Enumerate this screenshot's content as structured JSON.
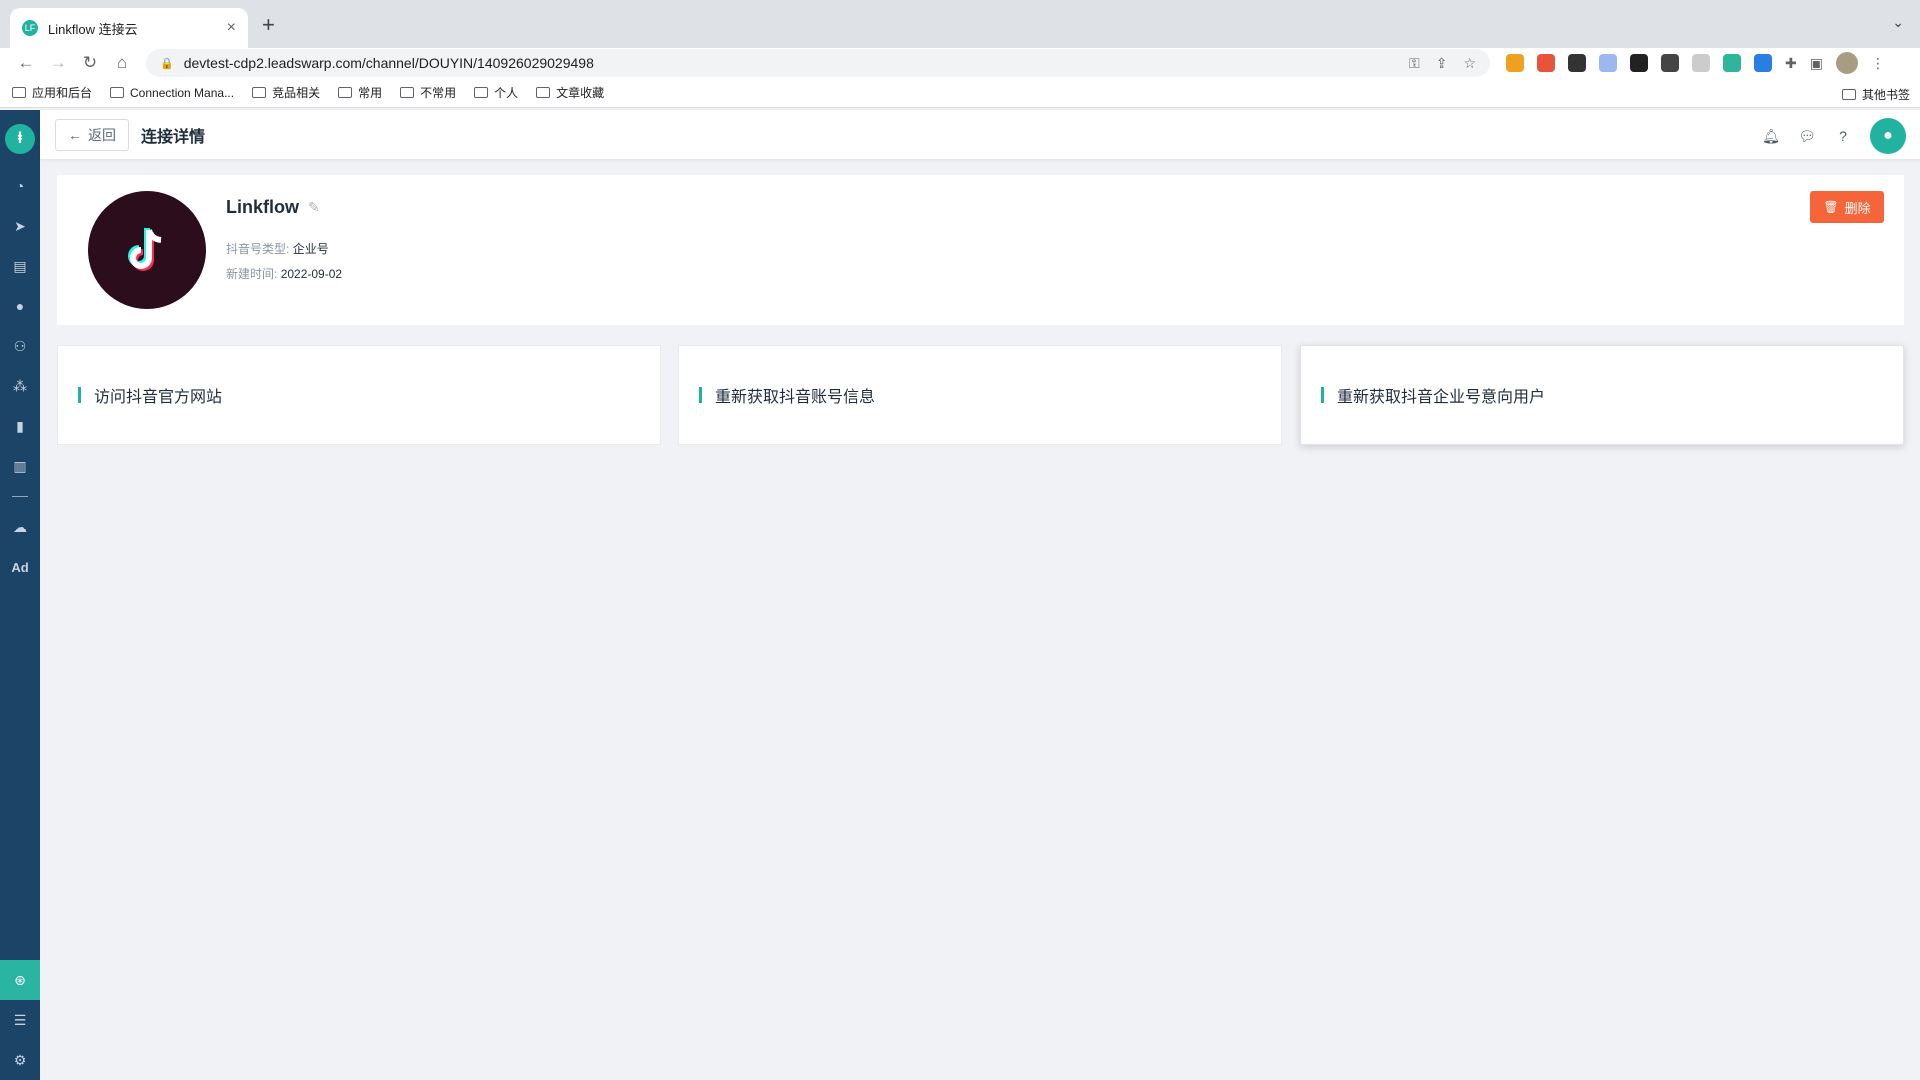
{
  "browser": {
    "tab_title": "Linkflow 连接云",
    "tab_close": "×",
    "new_tab": "+",
    "url": "devtest-cdp2.leadswarp.com/channel/DOUYIN/140926029029498",
    "bookmarks": [
      "应用和后台",
      "Connection Mana...",
      "竞品相关",
      "常用",
      "不常用",
      "个人",
      "文章收藏"
    ],
    "other_bookmarks": "其他书签"
  },
  "app": {
    "back_label": "返回",
    "page_title": "连接详情",
    "account": {
      "name": "Linkflow",
      "type_key": "抖音号类型:",
      "type_value": "企业号",
      "created_key": "新建时间:",
      "created_value": "2022-09-02"
    },
    "delete_label": "删除",
    "actions": [
      {
        "label": "访问抖音官方网站"
      },
      {
        "label": "重新获取抖音账号信息"
      },
      {
        "label": "重新获取抖音企业号意向用户"
      }
    ],
    "sidebar_text_icon": "Ad",
    "brand_color": "#22b3a0",
    "delete_color": "#f6643a",
    "sidebar_color": "#1b4467"
  }
}
